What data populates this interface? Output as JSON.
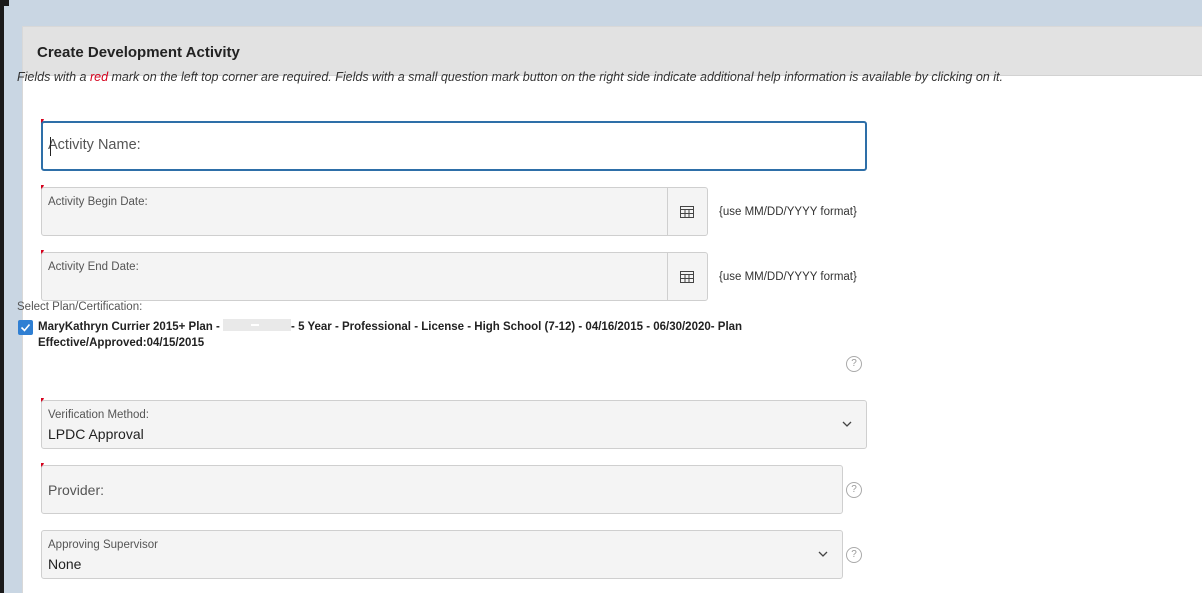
{
  "panel": {
    "title": "Create Development Activity"
  },
  "instructions": {
    "part1": "Fields with a ",
    "red_word": "red",
    "part2": " mark on the left top corner are required. Fields with a small question mark button on the right side indicate additional help information is available by clicking on it."
  },
  "form": {
    "activity_name": {
      "placeholder": "Activity Name:",
      "value": ""
    },
    "begin_date": {
      "label": "Activity Begin Date:",
      "value": "",
      "hint": "{use MM/DD/YYYY format}"
    },
    "end_date": {
      "label": "Activity End Date:",
      "value": "",
      "hint": "{use MM/DD/YYYY format}"
    },
    "plan": {
      "label": "Select Plan/Certification:",
      "checked": true,
      "text_before": "MaryKathryn Currier 2015+ Plan - ",
      "text_after": "- 5 Year - Professional - License - High School (7-12) - 04/16/2015 - 06/30/2020- Plan Effective/Approved:04/15/2015"
    },
    "verification": {
      "label": "Verification Method:",
      "value": "LPDC Approval"
    },
    "provider": {
      "label": "Provider:",
      "value": ""
    },
    "supervisor": {
      "label": "Approving Supervisor",
      "value": "None"
    }
  },
  "icons": {
    "calendar": "calendar-icon",
    "chevron": "chevron-down-icon",
    "help": "question-mark-icon",
    "check": "checkmark-icon"
  },
  "colors": {
    "required_mark": "#d6001c",
    "focus_border": "#2e6fa8",
    "checkbox": "#2f7fd3"
  },
  "help_glyph": "?"
}
